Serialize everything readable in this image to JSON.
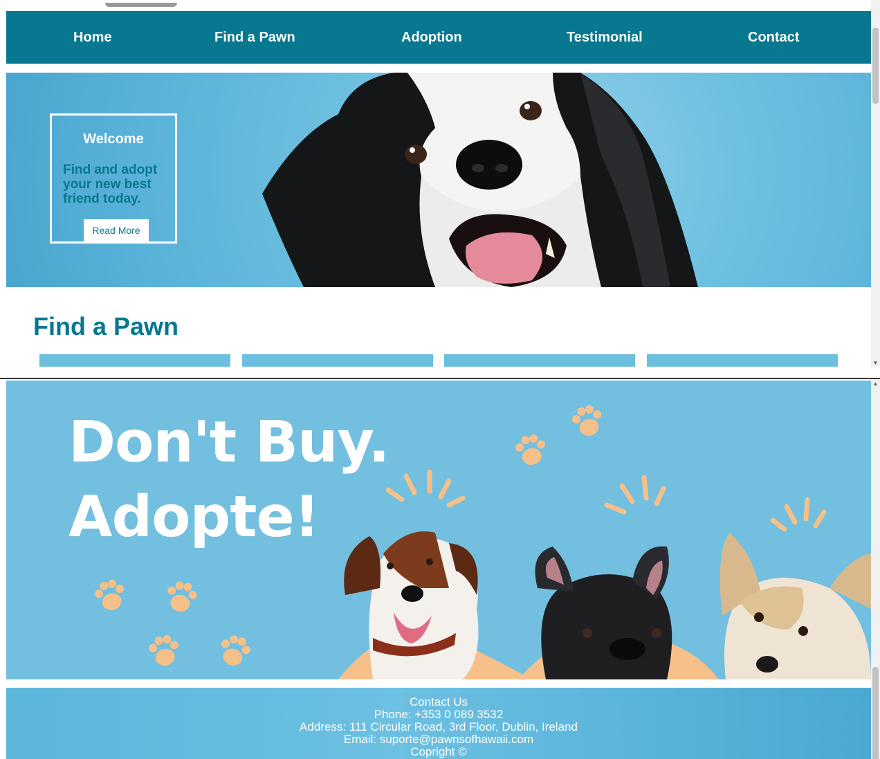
{
  "nav": {
    "items": [
      {
        "label": "Home"
      },
      {
        "label": "Find a Pawn"
      },
      {
        "label": "Adoption"
      },
      {
        "label": "Testimonial"
      },
      {
        "label": "Contact"
      }
    ]
  },
  "hero": {
    "welcome_title": "Welcome",
    "welcome_text": "Find and adopt your new best friend today.",
    "read_more_label": "Read More"
  },
  "find_section": {
    "title": "Find a Pawn"
  },
  "banner": {
    "line1": "Don't Buy.",
    "line2": "Adopte!"
  },
  "footer": {
    "heading": "Contact Us",
    "phone": "Phone: +353 0 089 3532",
    "address": "Address: 111 Circular Road, 3rd Floor, Dublin, Ireland",
    "email": "Email: suporte@pawnsofhawaii.com",
    "copyright": "Copright ©"
  },
  "colors": {
    "nav_bg": "#087890",
    "accent_text": "#087890",
    "hero_bg": "#6fc0e0",
    "banner_bg": "#73bfdf",
    "paw": "#f5c08a"
  }
}
